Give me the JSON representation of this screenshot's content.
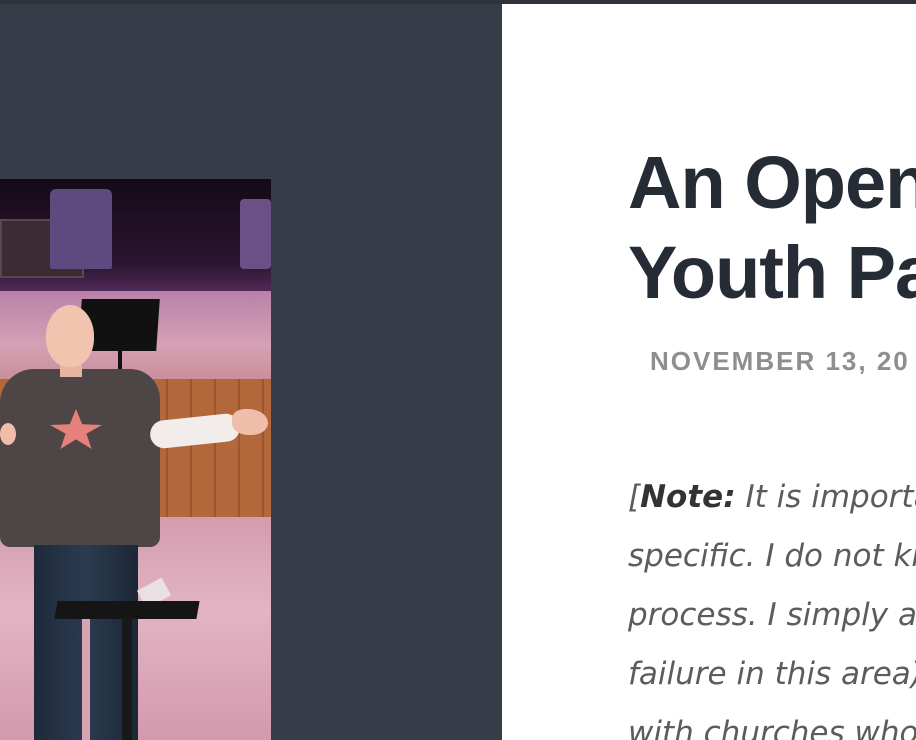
{
  "article": {
    "title_line1": "An Open",
    "title_line2": "Youth Pa",
    "date": "NOVEMBER 13, 20",
    "body": {
      "line1_open": "[",
      "line1_bold": "Note:",
      "line1_rest": " It is importan",
      "line2": "specific. I do not kno",
      "line3": "process. I simply am",
      "line4": "failure in this area) c",
      "line5": "with churches who c"
    }
  },
  "sidebar": {
    "photo_alt": "Speaker on stage"
  },
  "colors": {
    "sidebar_bg": "#373d48",
    "title": "#252c36",
    "date": "#8e8e8e",
    "body": "#5c5c5c"
  }
}
